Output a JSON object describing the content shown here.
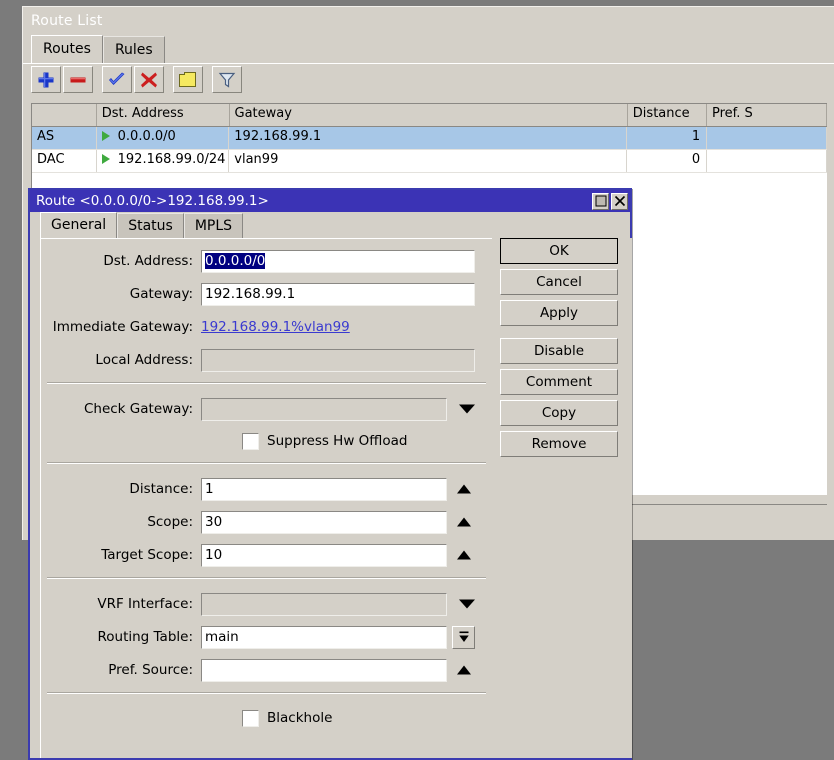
{
  "window": {
    "title": "Route List",
    "tabs": [
      {
        "label": "Routes",
        "active": true
      },
      {
        "label": "Rules",
        "active": false
      }
    ],
    "toolbar": [
      {
        "name": "add-button",
        "icon": "plus-icon"
      },
      {
        "name": "remove-button",
        "icon": "minus-icon"
      },
      {
        "name": "enable-button",
        "icon": "check-icon"
      },
      {
        "name": "disable-button",
        "icon": "cross-icon"
      },
      {
        "name": "comment-button",
        "icon": "note-icon"
      },
      {
        "name": "filter-button",
        "icon": "funnel-icon"
      }
    ],
    "table": {
      "columns": [
        "",
        "Dst. Address",
        "Gateway",
        "Distance",
        "Pref. S"
      ],
      "sorted_column": "Dst. Address",
      "rows": [
        {
          "flags": "AS",
          "dst_address": "0.0.0.0/0",
          "gateway": "192.168.99.1",
          "distance": "1",
          "pref_source": "",
          "selected": true
        },
        {
          "flags": "DAC",
          "dst_address": "192.168.99.0/24",
          "gateway": "vlan99",
          "distance": "0",
          "pref_source": "",
          "selected": false
        }
      ]
    },
    "status": ""
  },
  "dialog": {
    "title": "Route <0.0.0.0/0->192.168.99.1>",
    "title_buttons": [
      {
        "name": "maximize-button",
        "icon": "maximize-icon"
      },
      {
        "name": "close-button",
        "icon": "close-icon"
      }
    ],
    "tabs": [
      {
        "label": "General",
        "active": true
      },
      {
        "label": "Status",
        "active": false
      },
      {
        "label": "MPLS",
        "active": false
      }
    ],
    "fields": {
      "dst_address": {
        "label": "Dst. Address:",
        "value": "0.0.0.0/0",
        "selected": true
      },
      "gateway": {
        "label": "Gateway:",
        "value": "192.168.99.1"
      },
      "immediate_gateway": {
        "label": "Immediate Gateway:",
        "value": "192.168.99.1%vlan99"
      },
      "local_address": {
        "label": "Local Address:",
        "value": ""
      },
      "check_gateway": {
        "label": "Check Gateway:",
        "value": ""
      },
      "suppress_hw_offload": {
        "label": "Suppress Hw Offload",
        "checked": false
      },
      "distance": {
        "label": "Distance:",
        "value": "1"
      },
      "scope": {
        "label": "Scope:",
        "value": "30"
      },
      "target_scope": {
        "label": "Target Scope:",
        "value": "10"
      },
      "vrf_interface": {
        "label": "VRF Interface:",
        "value": ""
      },
      "routing_table": {
        "label": "Routing Table:",
        "value": "main"
      },
      "pref_source": {
        "label": "Pref. Source:",
        "value": ""
      },
      "blackhole": {
        "label": "Blackhole",
        "checked": false
      }
    },
    "buttons": [
      {
        "label": "OK",
        "name": "ok-button",
        "default": true
      },
      {
        "label": "Cancel",
        "name": "cancel-button",
        "default": false
      },
      {
        "label": "Apply",
        "name": "apply-button",
        "default": false
      },
      {
        "label": "Disable",
        "name": "disable-button",
        "default": false
      },
      {
        "label": "Comment",
        "name": "comment-button",
        "default": false
      },
      {
        "label": "Copy",
        "name": "copy-button",
        "default": false
      },
      {
        "label": "Remove",
        "name": "remove-button",
        "default": false
      }
    ]
  },
  "colors": {
    "desktop": "#7b7b7b",
    "face": "#d4d0c8",
    "selection": "#a7c7e7",
    "dialog_title": "#3b33b5",
    "link": "#3a3ad0",
    "text_selection": "#000080",
    "flag_arrow": "#3faa3f"
  }
}
